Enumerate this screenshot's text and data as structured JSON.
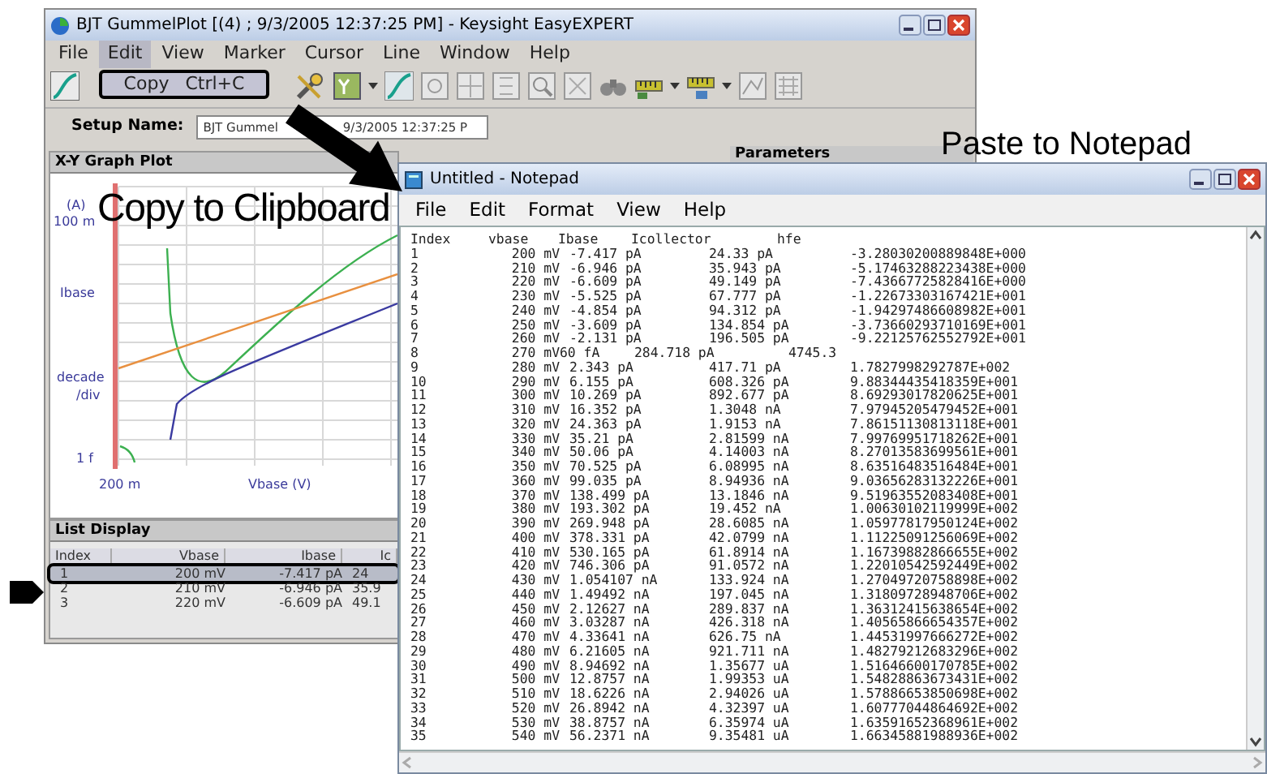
{
  "gummel_window": {
    "title": "BJT GummelPlot [(4) ; 9/3/2005 12:37:25 PM] - Keysight EasyEXPERT",
    "menu": [
      {
        "label": "File",
        "selected": false
      },
      {
        "label": "Edit",
        "selected": true
      },
      {
        "label": "View",
        "selected": false
      },
      {
        "label": "Marker",
        "selected": false
      },
      {
        "label": "Cursor",
        "selected": false
      },
      {
        "label": "Line",
        "selected": false
      },
      {
        "label": "Window",
        "selected": false
      },
      {
        "label": "Help",
        "selected": false
      }
    ],
    "edit_menu_item": {
      "label": "Copy",
      "shortcut": "Ctrl+C"
    },
    "setup_name": {
      "label": "Setup Name:",
      "value_parts": [
        "BJT Gummel",
        "9/3/2005 12:37:25 P"
      ]
    },
    "graph_panel": {
      "title": "X-Y Graph Plot",
      "y_unit": "(A)",
      "y_top": "100 m",
      "y_name": "Ibase",
      "y_scale": [
        "decade",
        "/div"
      ],
      "y_bottom": "1 f",
      "x_left": "200 m",
      "x_name": "Vbase (V)"
    },
    "parameters_panel": {
      "title": "Parameters"
    },
    "list_display": {
      "title": "List Display",
      "columns": [
        "Index",
        "Vbase",
        "Ibase",
        "Ic"
      ],
      "rows": [
        {
          "cells": [
            "1",
            "200 mV",
            "-7.417 pA",
            "24"
          ],
          "selected": true
        },
        {
          "cells": [
            "2",
            "210 mV",
            "-6.946 pA",
            "35.9"
          ],
          "selected": false
        },
        {
          "cells": [
            "3",
            "220 mV",
            "-6.609 pA",
            "49.1"
          ],
          "selected": false
        }
      ]
    }
  },
  "notepad_window": {
    "title": "Untitled - Notepad",
    "menu": [
      "File",
      "Edit",
      "Format",
      "View",
      "Help"
    ],
    "columns": [
      "Index",
      "vbase",
      "Ibase",
      "Icollector",
      "hfe"
    ],
    "rows": [
      {
        "kind": "aligned",
        "cells": [
          "1",
          "200 mV",
          "-7.417 pA",
          "24.33 pA",
          "-3.28030200889848E+000"
        ]
      },
      {
        "kind": "aligned",
        "cells": [
          "2",
          "210 mV",
          "-6.946 pA",
          "35.943 pA",
          "-5.17463288223438E+000"
        ]
      },
      {
        "kind": "aligned",
        "cells": [
          "3",
          "220 mV",
          "-6.609 pA",
          "49.149 pA",
          "-7.43667725828416E+000"
        ]
      },
      {
        "kind": "aligned",
        "cells": [
          "4",
          "230 mV",
          "-5.525 pA",
          "67.777 pA",
          "-1.22673303167421E+001"
        ]
      },
      {
        "kind": "aligned",
        "cells": [
          "5",
          "240 mV",
          "-4.854 pA",
          "94.312 pA",
          "-1.94297486608982E+001"
        ]
      },
      {
        "kind": "aligned",
        "cells": [
          "6",
          "250 mV",
          "-3.609 pA",
          "134.854 pA",
          "-3.73660293710169E+001"
        ]
      },
      {
        "kind": "aligned",
        "cells": [
          "7",
          "260 mV",
          "-2.131 pA",
          "196.505 pA",
          "-9.22125762552792E+001"
        ]
      },
      {
        "kind": "shifted",
        "cells": [
          "8",
          "270 mV",
          "60 fA",
          "284.718 pA",
          "4745.3"
        ]
      },
      {
        "kind": "aligned",
        "cells": [
          "9",
          "280 mV",
          "2.343 pA",
          "417.71 pA",
          "1.7827998292787E+002"
        ]
      },
      {
        "kind": "aligned",
        "cells": [
          "10",
          "290 mV",
          "6.155 pA",
          "608.326 pA",
          "9.88344435418359E+001"
        ]
      },
      {
        "kind": "aligned",
        "cells": [
          "11",
          "300 mV",
          "10.269 pA",
          "892.677 pA",
          "8.69293017820625E+001"
        ]
      },
      {
        "kind": "aligned",
        "cells": [
          "12",
          "310 mV",
          "16.352 pA",
          "1.3048 nA",
          "7.97945205479452E+001"
        ]
      },
      {
        "kind": "aligned",
        "cells": [
          "13",
          "320 mV",
          "24.363 pA",
          "1.9153 nA",
          "7.86151130813118E+001"
        ]
      },
      {
        "kind": "aligned",
        "cells": [
          "14",
          "330 mV",
          "35.21 pA",
          "2.81599 nA",
          "7.99769951718262E+001"
        ]
      },
      {
        "kind": "aligned",
        "cells": [
          "15",
          "340 mV",
          "50.06 pA",
          "4.14003 nA",
          "8.27013583699561E+001"
        ]
      },
      {
        "kind": "aligned",
        "cells": [
          "16",
          "350 mV",
          "70.525 pA",
          "6.08995 nA",
          "8.63516483516484E+001"
        ]
      },
      {
        "kind": "aligned",
        "cells": [
          "17",
          "360 mV",
          "99.035 pA",
          "8.94936 nA",
          "9.03656283132226E+001"
        ]
      },
      {
        "kind": "aligned",
        "cells": [
          "18",
          "370 mV",
          "138.499 pA",
          "13.1846 nA",
          "9.51963552083408E+001"
        ]
      },
      {
        "kind": "aligned",
        "cells": [
          "19",
          "380 mV",
          "193.302 pA",
          "19.452 nA",
          "1.00630102119999E+002"
        ]
      },
      {
        "kind": "aligned",
        "cells": [
          "20",
          "390 mV",
          "269.948 pA",
          "28.6085 nA",
          "1.05977817950124E+002"
        ]
      },
      {
        "kind": "aligned",
        "cells": [
          "21",
          "400 mV",
          "378.331 pA",
          "42.0799 nA",
          "1.11225091256069E+002"
        ]
      },
      {
        "kind": "aligned",
        "cells": [
          "22",
          "410 mV",
          "530.165 pA",
          "61.8914 nA",
          "1.16739882866655E+002"
        ]
      },
      {
        "kind": "aligned",
        "cells": [
          "23",
          "420 mV",
          "746.306 pA",
          "91.0572 nA",
          "1.22010542592449E+002"
        ]
      },
      {
        "kind": "aligned",
        "cells": [
          "24",
          "430 mV",
          "1.054107 nA",
          "133.924 nA",
          "1.27049720758898E+002"
        ]
      },
      {
        "kind": "aligned",
        "cells": [
          "25",
          "440 mV",
          "1.49492 nA",
          "197.045 nA",
          "1.31809728948706E+002"
        ]
      },
      {
        "kind": "aligned",
        "cells": [
          "26",
          "450 mV",
          "2.12627 nA",
          "289.837 nA",
          "1.36312415638654E+002"
        ]
      },
      {
        "kind": "aligned",
        "cells": [
          "27",
          "460 mV",
          "3.03287 nA",
          "426.318 nA",
          "1.40565866654357E+002"
        ]
      },
      {
        "kind": "aligned",
        "cells": [
          "28",
          "470 mV",
          "4.33641 nA",
          "626.75 nA",
          "1.44531997666272E+002"
        ]
      },
      {
        "kind": "aligned",
        "cells": [
          "29",
          "480 mV",
          "6.21605 nA",
          "921.711 nA",
          "1.48279212683296E+002"
        ]
      },
      {
        "kind": "aligned",
        "cells": [
          "30",
          "490 mV",
          "8.94692 nA",
          "1.35677 uA",
          "1.51646600170785E+002"
        ]
      },
      {
        "kind": "aligned",
        "cells": [
          "31",
          "500 mV",
          "12.8757 nA",
          "1.99353 uA",
          "1.54828863673431E+002"
        ]
      },
      {
        "kind": "aligned",
        "cells": [
          "32",
          "510 mV",
          "18.6226 nA",
          "2.94026 uA",
          "1.57886653850698E+002"
        ]
      },
      {
        "kind": "aligned",
        "cells": [
          "33",
          "520 mV",
          "26.8942 nA",
          "4.32397 uA",
          "1.60777044864692E+002"
        ]
      },
      {
        "kind": "aligned",
        "cells": [
          "34",
          "530 mV",
          "38.8757 nA",
          "6.35974 uA",
          "1.63591652368961E+002"
        ]
      },
      {
        "kind": "aligned",
        "cells": [
          "35",
          "540 mV",
          "56.2371 nA",
          "9.35481 uA",
          "1.66345881988936E+002"
        ]
      }
    ]
  },
  "annotations": [
    {
      "text": "Copy to Clipboard"
    },
    {
      "text": "Paste to Notepad"
    }
  ]
}
